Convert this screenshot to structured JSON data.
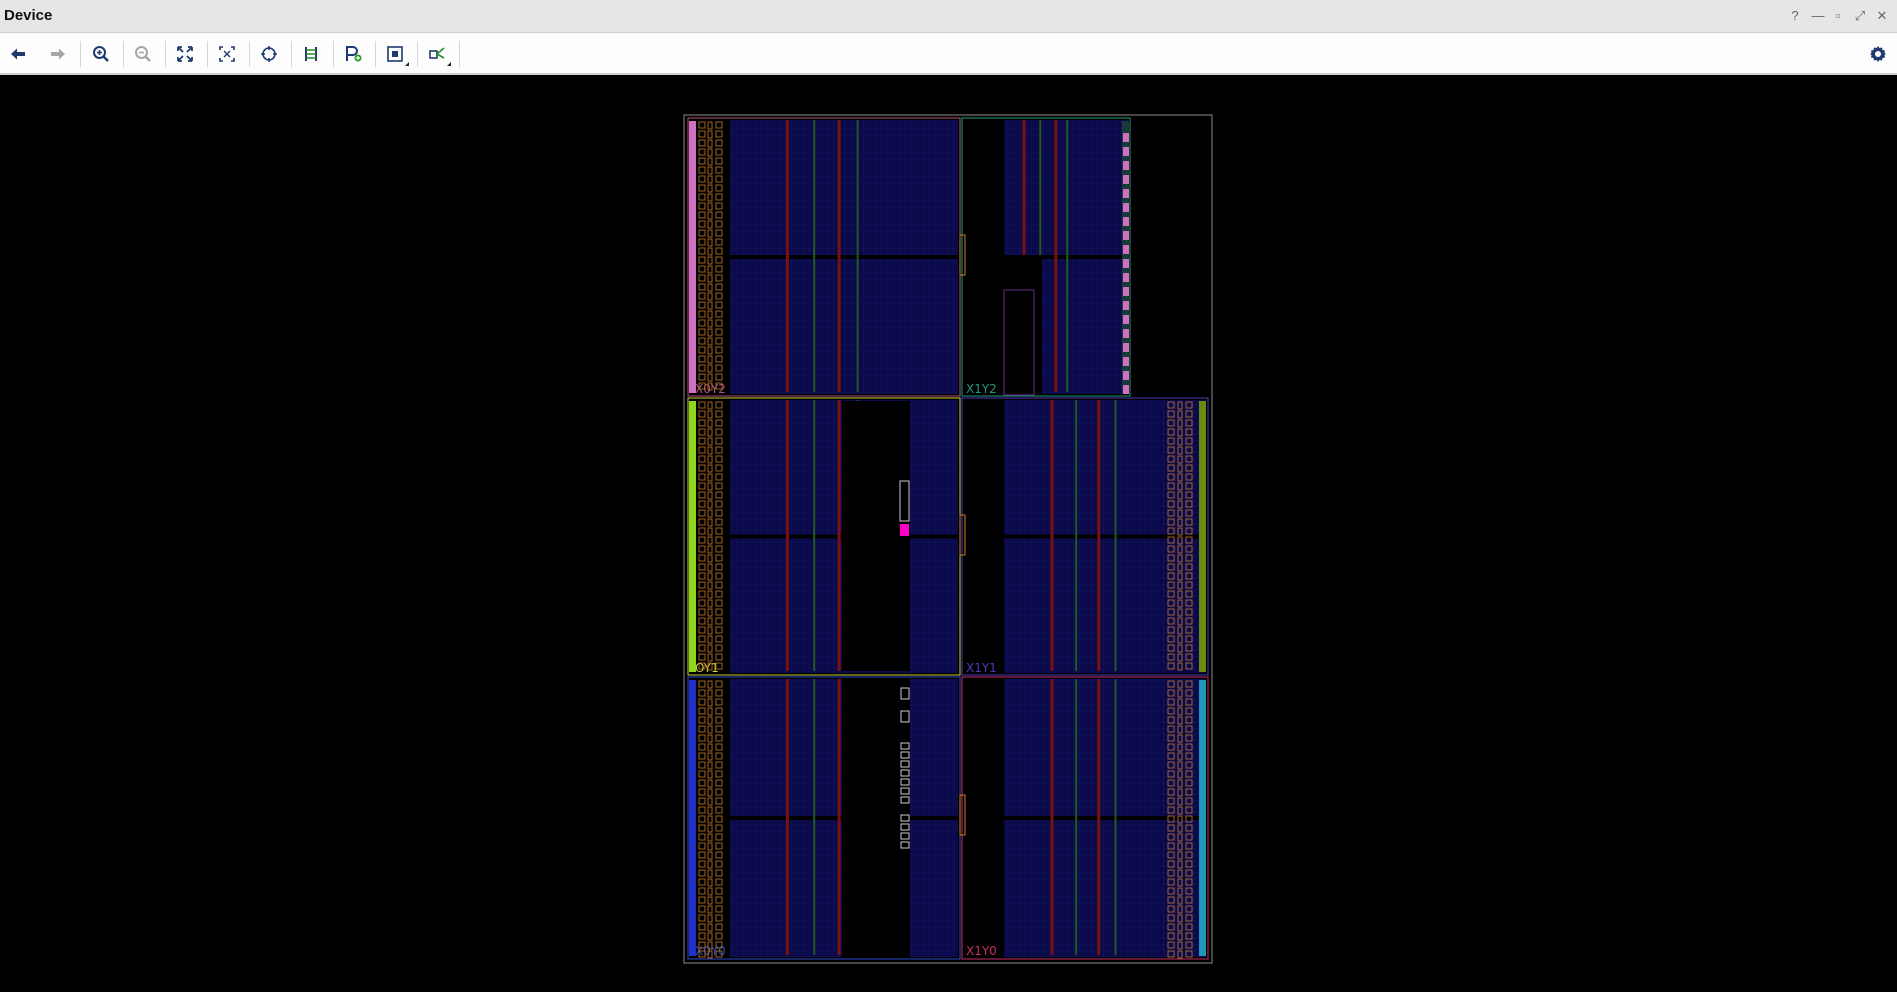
{
  "window": {
    "title": "Device"
  },
  "window_controls": {
    "help": "?",
    "minimize": "—",
    "restore": "▫",
    "maximize": "⤢",
    "close": "✕"
  },
  "toolbar": {
    "buttons": [
      {
        "icon": "back-arrow-icon",
        "enabled": true
      },
      {
        "icon": "forward-arrow-icon",
        "enabled": false
      },
      {
        "icon": "zoom-in-icon",
        "enabled": true
      },
      {
        "icon": "zoom-out-icon",
        "enabled": false
      },
      {
        "icon": "zoom-fit-icon",
        "enabled": true
      },
      {
        "icon": "zoom-to-selected-icon",
        "enabled": true
      },
      {
        "icon": "autofit-selection-icon",
        "enabled": true
      },
      {
        "icon": "routing-resources-icon",
        "enabled": true
      },
      {
        "icon": "create-pblock-icon",
        "enabled": true
      },
      {
        "icon": "select-area-icon",
        "enabled": true
      },
      {
        "icon": "show-connectivity-icon",
        "enabled": true
      }
    ],
    "settings_icon": "gear-icon"
  },
  "device": {
    "clock_regions": [
      {
        "name": "X0Y2",
        "color": "#b0507f"
      },
      {
        "name": "X1Y2",
        "color": "#1f9a7c"
      },
      {
        "name": "X0Y1",
        "color": "#c7cf3a"
      },
      {
        "name": "X1Y1",
        "color": "#4d3ab8"
      },
      {
        "name": "X0Y0",
        "color": "#2b49c6"
      },
      {
        "name": "X1Y0",
        "color": "#c43067"
      }
    ],
    "label_prefix_clipped": {
      "X0Y1": "OY1"
    }
  },
  "colors": {
    "fabric": "#0a0a4a",
    "fabric_grid": "#1a1a6a",
    "io_orange": "#c87b2a",
    "device_border": "#8a8a8a",
    "column_red": "#7a1010",
    "column_green": "#1f5a1f",
    "highlight_magenta": "#ff00c8",
    "io_bank_lime": "#8fd61f",
    "io_bank_blue": "#1f2fc8",
    "io_bank_olive": "#6a8a12",
    "io_bank_cyan": "#1f97b8",
    "io_bank_pink": "#d070c0"
  }
}
